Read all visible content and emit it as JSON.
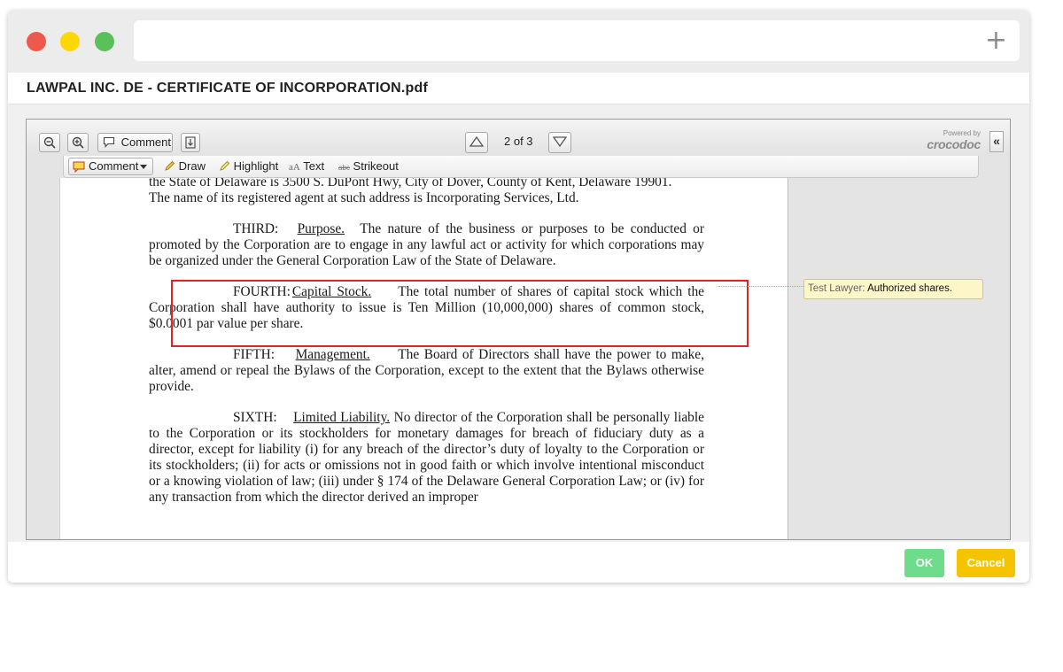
{
  "window": {
    "title": "LAWPAL INC. DE - CERTIFICATE OF INCORPORATION.pdf",
    "new_tab_symbol": "+"
  },
  "toolbar": {
    "comment_label": "Comment",
    "page_indicator": "2 of 3",
    "powered_by": "Powered by",
    "brand": "crocodoc",
    "collapse_symbol": "«"
  },
  "annotation_toolbar": {
    "comment_dropdown": "Comment",
    "draw": "Draw",
    "highlight": "Highlight",
    "text": "Text",
    "text_icon": "aA",
    "strikeout": "Strikeout",
    "strikeout_icon": "abc"
  },
  "document": {
    "line_a1": "the State of Delaware is 3500 S. DuPont Hwy, City of Dover, County of Kent, Delaware 19901.",
    "line_a2": "The name of its registered agent at such address is Incorporating Services, Ltd.",
    "third_heading": "THIRD:",
    "third_title": "Purpose.",
    "third_body_1": "The nature of the business or purposes to be conducted or",
    "third_body_2": "promoted by the Corporation are to engage in any lawful act or activity for which corporations may be organized under the General Corporation Law of the State of Delaware.",
    "fourth_heading": "FOURTH:",
    "fourth_title": "Capital Stock.",
    "fourth_body_1": "The total number of shares of capital stock which",
    "fourth_body_2": "the Corporation shall have authority to issue is Ten Million (10,000,000) shares of common stock, $0.0001 par value per share.",
    "fifth_heading": "FIFTH:",
    "fifth_title": "Management.",
    "fifth_body_1": "The Board of Directors shall have the power to",
    "fifth_body_2": "make, alter, amend or repeal the Bylaws of the Corporation, except to the extent that the Bylaws otherwise provide.",
    "sixth_heading": "SIXTH:",
    "sixth_title": "Limited Liability.",
    "sixth_body_1": "No director of the Corporation shall be personally",
    "sixth_body_2": "liable to the Corporation or its stockholders for monetary damages for breach of fiduciary duty as a director, except for liability (i) for any breach of the director’s duty of loyalty to the Corporation or its stockholders; (ii) for acts or omissions not in good faith or which involve intentional misconduct or a knowing violation of law; (iii) under § 174 of the Delaware General Corporation Law; or (iv) for any transaction from which the director derived an improper"
  },
  "comment": {
    "author": "Test Lawyer:",
    "text": "Authorized shares."
  },
  "footer": {
    "ok_label": "OK",
    "cancel_label": "Cancel"
  },
  "colors": {
    "ok": "#6fdc8c",
    "cancel": "#f5c400",
    "highlight_box": "#e02424",
    "note_background": "#fdf6c8"
  }
}
